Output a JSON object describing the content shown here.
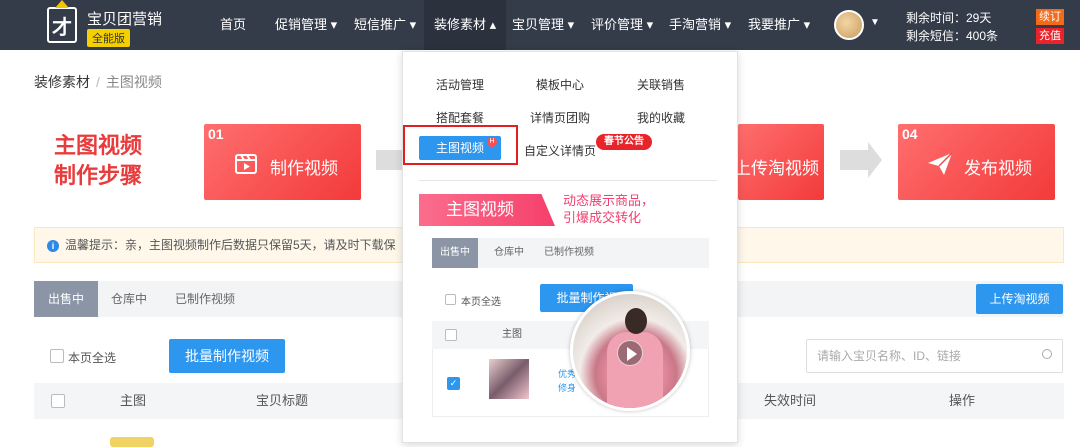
{
  "header": {
    "logo_glyph": "才",
    "brand": "宝贝团营销",
    "edition": "全能版",
    "nav": [
      {
        "label": "首页"
      },
      {
        "label": "促销管理 ▾"
      },
      {
        "label": "短信推广 ▾"
      },
      {
        "label": "装修素材 ▴"
      },
      {
        "label": "宝贝管理 ▾"
      },
      {
        "label": "评价管理 ▾"
      },
      {
        "label": "手淘营销 ▾"
      },
      {
        "label": "我要推广 ▾"
      }
    ],
    "remain_time": "剩余时间：29天",
    "remain_sms": "剩余短信：400条",
    "renew_label": "续订",
    "recharge_label": "充值",
    "accent": "#f36a18",
    "recharge_color": "#e8232a"
  },
  "breadcrumb": {
    "parent": "装修素材",
    "sep": "/",
    "current": "主图视频"
  },
  "steps": {
    "title_line1": "主图视频",
    "title_line2": "制作步骤",
    "items": [
      {
        "num": "01",
        "label": "制作视频",
        "icon": "clapperboard-icon"
      },
      {
        "num": "",
        "label": "上传淘视频",
        "icon": ""
      },
      {
        "num": "04",
        "label": "发布视频",
        "icon": "paper-plane-icon"
      }
    ]
  },
  "tip": {
    "text": "温馨提示：亲，主图视频制作后数据只保留5天，请及时下载保"
  },
  "tabs": [
    {
      "label": "出售中"
    },
    {
      "label": "仓库中"
    },
    {
      "label": "已制作视频"
    }
  ],
  "upload_button": "上传淘视频",
  "select_all": "本页全选",
  "batch_button": "批量制作视频",
  "search_placeholder": "请输入宝贝名称、ID、链接",
  "table": {
    "headers": [
      "主图",
      "宝贝标题",
      "失效时间",
      "操作"
    ]
  },
  "dropdown": {
    "items": [
      {
        "label": "活动管理"
      },
      {
        "label": "模板中心"
      },
      {
        "label": "关联销售"
      },
      {
        "label": "搭配套餐"
      },
      {
        "label": "详情页团购"
      },
      {
        "label": "我的收藏"
      },
      {
        "label": "主图视频"
      },
      {
        "label": "自定义详情页"
      }
    ],
    "hot_badge": "H",
    "spring_badge": "春节公告",
    "promo_title": "主图视频",
    "promo_line1": "动态展示商品，",
    "promo_line2": "引爆成交转化",
    "mini_tabs": [
      "出售中",
      "仓库中",
      "已制作视频"
    ],
    "mini_select_all": "本页全选",
    "mini_batch": "批量制作视",
    "mini_header": "主图",
    "mini_link1": "优秀",
    "mini_link2": "修身"
  }
}
